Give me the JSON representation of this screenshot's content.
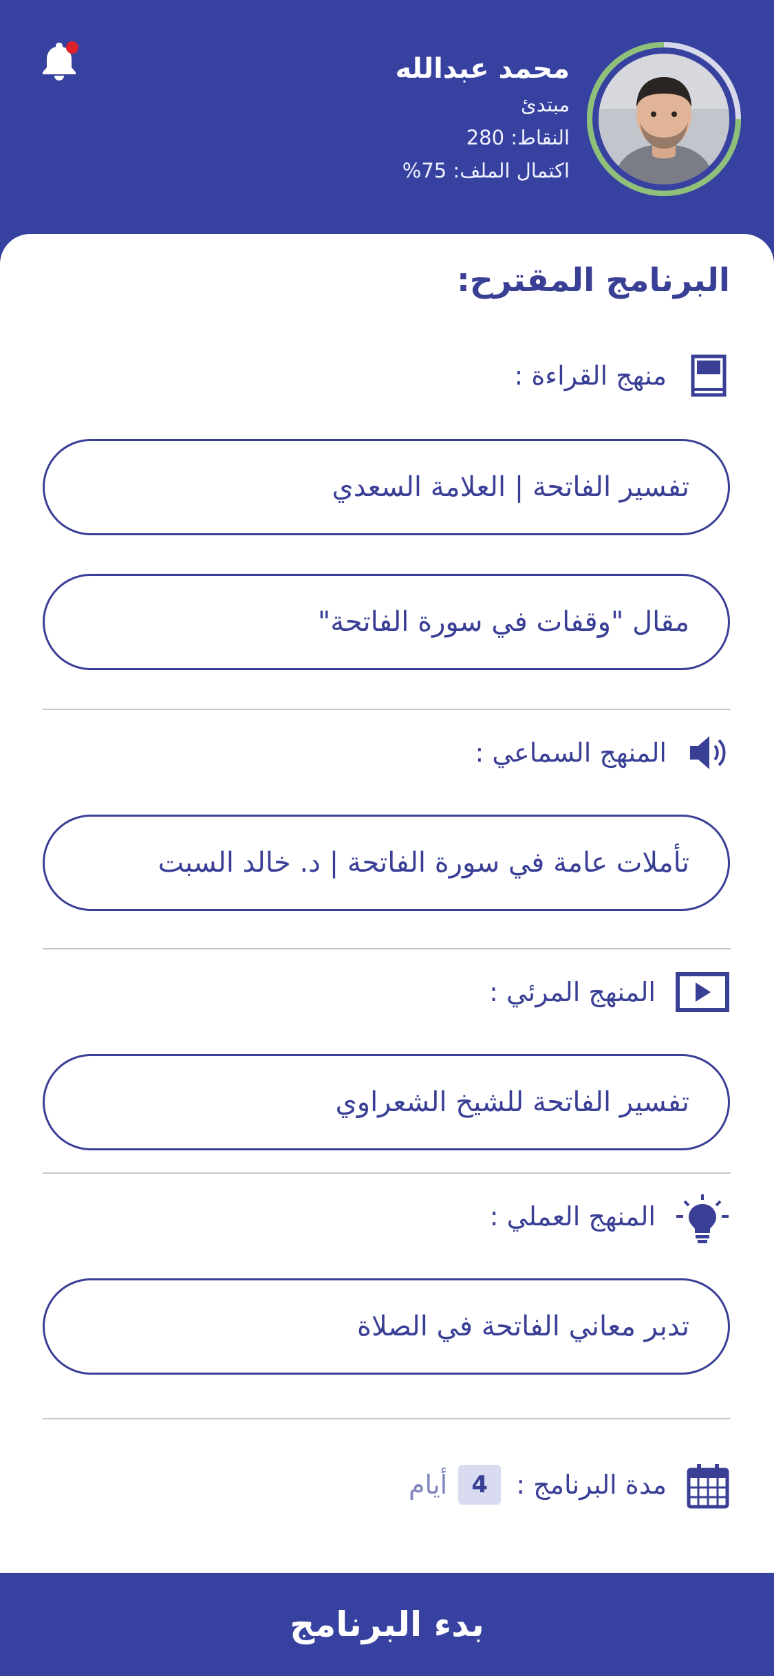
{
  "profile": {
    "name": "محمد عبدالله",
    "level": "مبتدئ",
    "points": "النقاط: 280",
    "completion": "اكتمال الملف: 75%",
    "completion_fraction": 0.75,
    "ring_color": "#8fc07a",
    "ring_track_color": "#d7d9ea"
  },
  "notifications": {
    "icon": "bell-icon",
    "has_unread": true
  },
  "program": {
    "title": "البرنامج المقترح:",
    "sections": [
      {
        "label": "منهج القراءة :",
        "icon": "book-icon",
        "items": [
          "تفسير الفاتحة | العلامة السعدي",
          "مقال \"وقفات في سورة الفاتحة\""
        ]
      },
      {
        "label": "المنهج السماعي :",
        "icon": "speaker-icon",
        "items": [
          "تأملات عامة في سورة الفاتحة | د. خالد السبت"
        ]
      },
      {
        "label": "المنهج المرئي :",
        "icon": "video-icon",
        "items": [
          "تفسير الفاتحة للشيخ الشعراوي"
        ]
      },
      {
        "label": "المنهج العملي :",
        "icon": "lightbulb-icon",
        "items": [
          "تدبر معاني الفاتحة في الصلاة"
        ]
      }
    ],
    "duration": {
      "label": "مدة البرنامج :",
      "value": "4",
      "unit": "أيام",
      "icon": "calendar-icon"
    }
  },
  "start_button": {
    "label": "بدء البرنامج"
  },
  "colors": {
    "primary": "#3741a0",
    "text": "#3a3f96",
    "notification_dot": "#e0212b",
    "badge_bg": "#d9dcf1"
  }
}
